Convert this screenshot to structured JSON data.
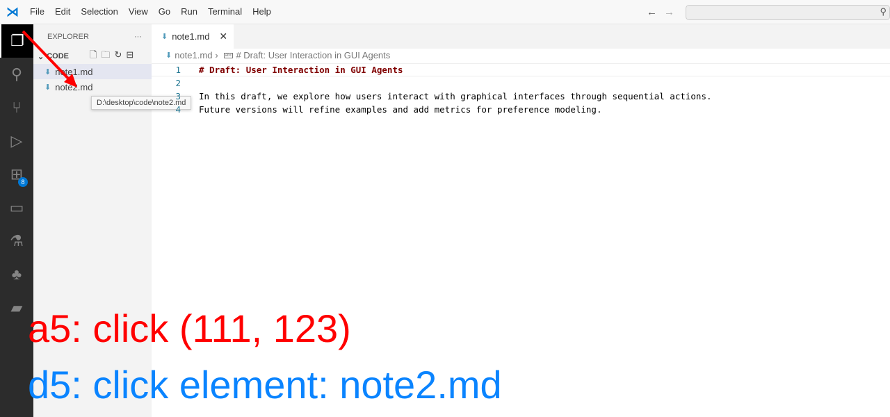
{
  "menu": [
    "File",
    "Edit",
    "Selection",
    "View",
    "Go",
    "Run",
    "Terminal",
    "Help"
  ],
  "sidebar": {
    "title": "EXPLORER",
    "folder": "CODE",
    "files": [
      "note1.md",
      "note2.md"
    ],
    "tooltip": "D:\\desktop\\code\\note2.md",
    "activity_badge": "8"
  },
  "tab": {
    "label": "note1.md"
  },
  "breadcrumb": {
    "file": "note1.md",
    "symbol": "# Draft: User Interaction in GUI Agents"
  },
  "editor": {
    "lines": [
      {
        "n": "1",
        "text": "# Draft: User Interaction in GUI Agents"
      },
      {
        "n": "2",
        "text": ""
      },
      {
        "n": "3",
        "text": "In this draft, we explore how users interact with graphical interfaces through sequential actions."
      },
      {
        "n": "4",
        "text": "Future versions will refine examples and add metrics for preference modeling."
      }
    ]
  },
  "annotation": {
    "action": "a5: click (111, 123)",
    "description": "d5: click element: note2.md",
    "action_color": "#ff0000",
    "description_color": "#0a84ff"
  }
}
